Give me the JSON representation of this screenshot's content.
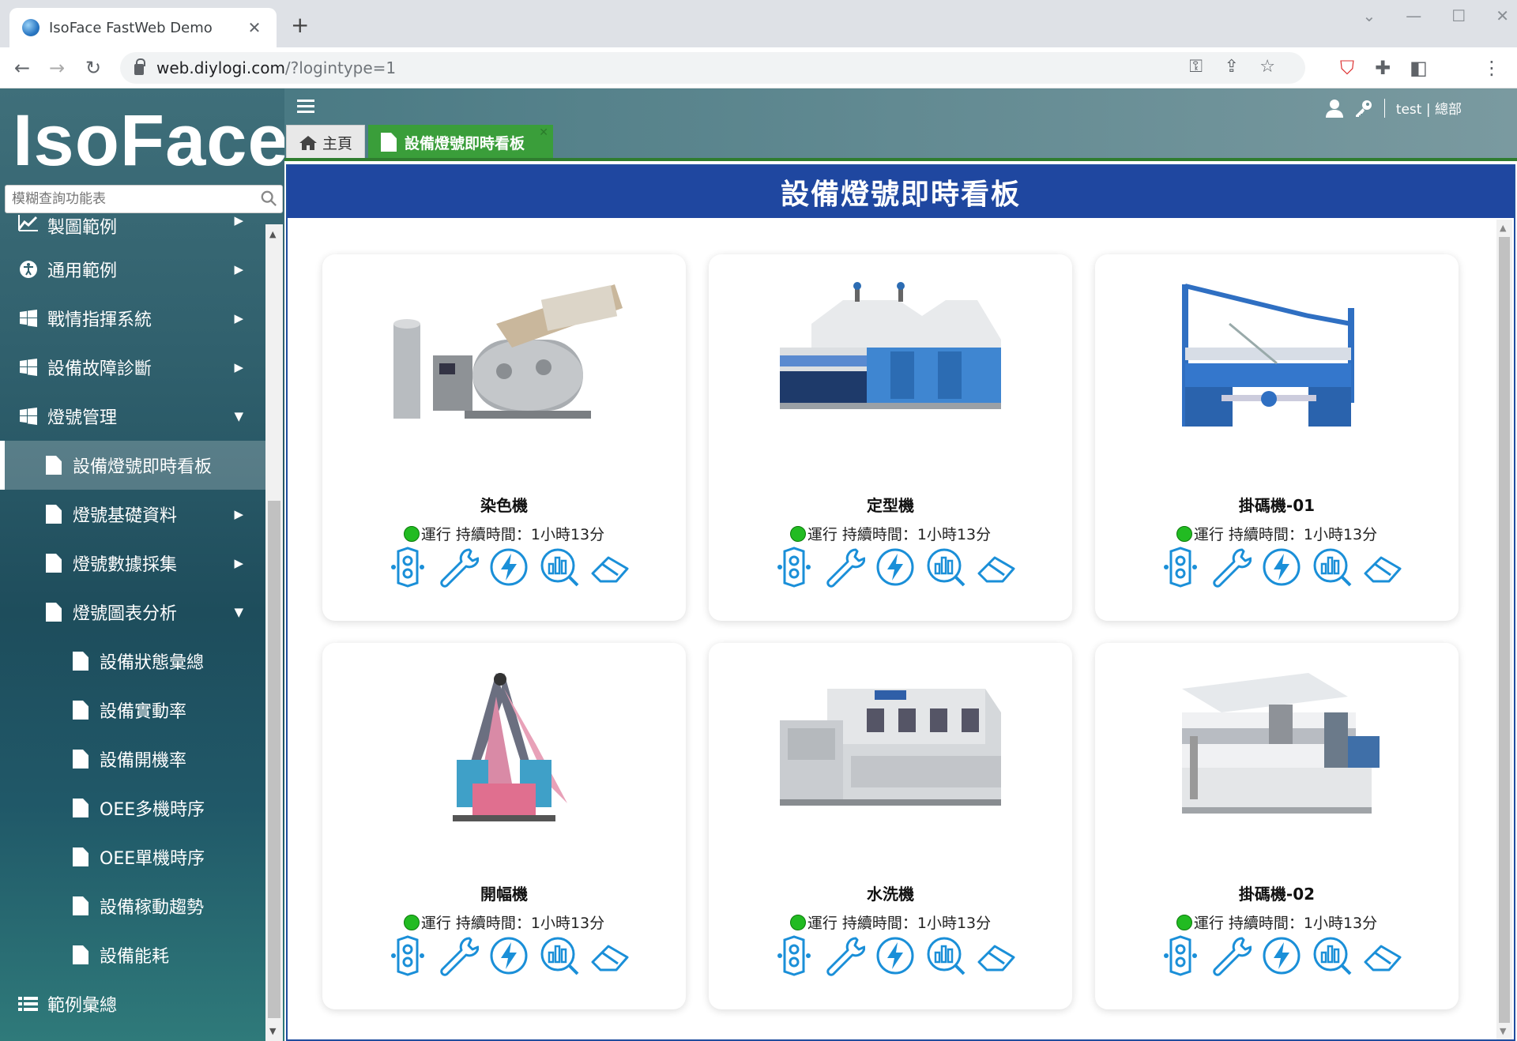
{
  "browser": {
    "tab_title": "IsoFace FastWeb Demo",
    "new_tab": "+",
    "url_host": "web.diylogi.com",
    "url_path": "/?logintype=1"
  },
  "app": {
    "logo": "IsoFace",
    "search_placeholder": "模糊查詢功能表",
    "user_label": "test | 總部",
    "tabs": {
      "home": "主頁",
      "board": "設備燈號即時看板"
    },
    "page_title": "設備燈號即時看板"
  },
  "menu": [
    {
      "label": "製圖範例",
      "icon": "chart-line-icon"
    },
    {
      "label": "通用範例",
      "icon": "accessibility-icon"
    },
    {
      "label": "戰情指揮系統",
      "icon": "windows-icon"
    },
    {
      "label": "設備故障診斷",
      "icon": "windows-icon"
    },
    {
      "label": "燈號管理",
      "icon": "windows-icon"
    },
    {
      "label": "設備燈號即時看板",
      "icon": "document-icon"
    },
    {
      "label": "燈號基礎資料",
      "icon": "document-icon"
    },
    {
      "label": "燈號數據採集",
      "icon": "document-icon"
    },
    {
      "label": "燈號圖表分析",
      "icon": "document-icon"
    },
    {
      "label": "設備狀態彙總",
      "icon": "document-icon"
    },
    {
      "label": "設備實動率",
      "icon": "document-icon"
    },
    {
      "label": "設備開機率",
      "icon": "document-icon"
    },
    {
      "label": "OEE多機時序",
      "icon": "document-icon"
    },
    {
      "label": "OEE單機時序",
      "icon": "document-icon"
    },
    {
      "label": "設備稼動趨勢",
      "icon": "document-icon"
    },
    {
      "label": "設備能耗",
      "icon": "document-icon"
    },
    {
      "label": "範例彙總",
      "icon": "list-icon"
    }
  ],
  "machines": [
    {
      "name": "染色機",
      "status": "運行 持續時間：1小時13分"
    },
    {
      "name": "定型機",
      "status": "運行 持續時間：1小時13分"
    },
    {
      "name": "掛碼機-01",
      "status": "運行 持續時間：1小時13分"
    },
    {
      "name": "開幅機",
      "status": "運行 持續時間：1小時13分"
    },
    {
      "name": "水洗機",
      "status": "運行 持續時間：1小時13分"
    },
    {
      "name": "掛碼機-02",
      "status": "運行 持續時間：1小時13分"
    }
  ],
  "colors": {
    "header_blue": "#1f47a0",
    "tab_green": "#3a9e3a",
    "status_green": "#22bb22",
    "tool_blue": "#1a8fd8"
  }
}
